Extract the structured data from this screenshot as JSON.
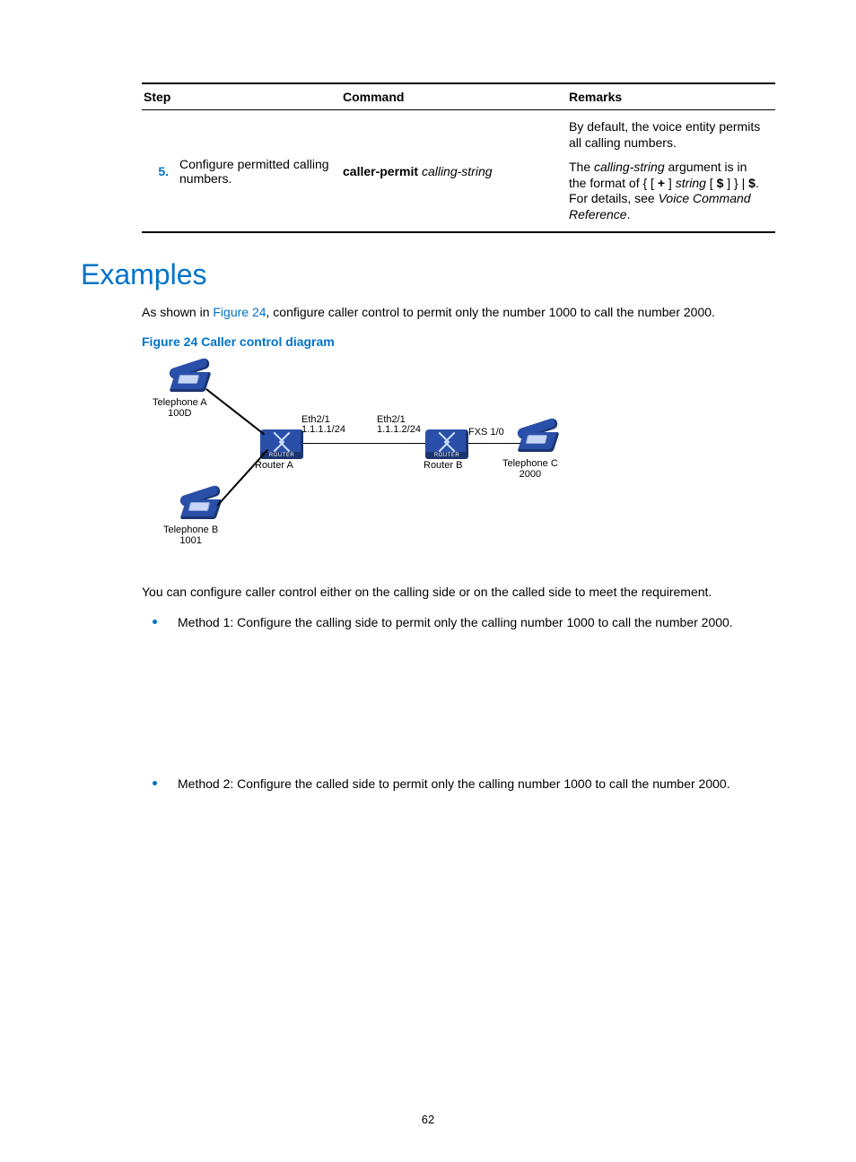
{
  "table": {
    "headers": {
      "step": "Step",
      "command": "Command",
      "remarks": "Remarks"
    },
    "row": {
      "num": "5.",
      "desc": "Configure permitted calling numbers.",
      "cmd_bold": "caller-permit",
      "cmd_it": "calling-string",
      "remarks1": "By default, the voice entity permits all calling numbers.",
      "remarks2_a": "The ",
      "remarks2_it1": "calling-string",
      "remarks2_b": " argument is in the format of { [ ",
      "remarks2_plus": "+",
      "remarks2_c": " ] ",
      "remarks2_it2": "string",
      "remarks2_d": " [ ",
      "remarks2_dol1": "$",
      "remarks2_e": " ] } | ",
      "remarks2_dol2": "$",
      "remarks2_f": ". For details, see ",
      "remarks2_it3": "Voice Command Reference",
      "remarks2_g": "."
    }
  },
  "section_title": "Examples",
  "intro_a": "As shown in ",
  "intro_link": "Figure 24",
  "intro_b": ", configure caller control to permit only the number 1000 to call the number 2000.",
  "fig_caption": "Figure 24 Caller control diagram",
  "diagram": {
    "telA": "Telephone A\n100D",
    "telB": "Telephone B\n1001",
    "telC": "Telephone C\n2000",
    "routerA": "Router A",
    "routerB": "Router B",
    "ethA": "Eth2/1\n1.1.1.1/24",
    "ethB": "Eth2/1\n1.1.1.2/24",
    "fxs": "FXS 1/0",
    "router_tag": "ROUTER"
  },
  "follow": "You can configure caller control either on the calling side or on the called side to meet the requirement.",
  "method1": "Method 1: Configure the calling side to permit only the calling number 1000 to call the number 2000.",
  "method2": "Method 2: Configure the called side to permit only the calling number 1000 to call the number 2000.",
  "page_number": "62"
}
